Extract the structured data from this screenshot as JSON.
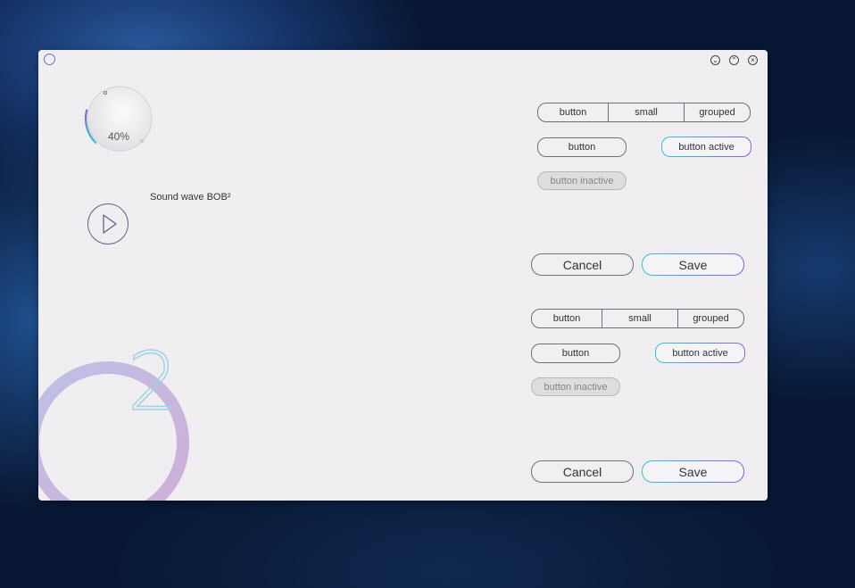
{
  "window": {
    "controls": [
      "minimize-icon",
      "maximize-icon",
      "close-icon"
    ],
    "min_glyph": "⌄",
    "max_glyph": "⌃",
    "close_glyph": "×"
  },
  "dial": {
    "value_label": "40%",
    "value": 0.4
  },
  "audio": {
    "label": "Sound wave BOB²",
    "play_icon": "play-icon"
  },
  "deco": {
    "digit": "2"
  },
  "panel1": {
    "group": [
      "button",
      "small",
      "grouped"
    ],
    "button": "button",
    "button_active": "button active",
    "button_inactive": "button inactive",
    "cancel": "Cancel",
    "save": "Save"
  },
  "panel2": {
    "group": [
      "button",
      "small",
      "grouped"
    ],
    "button": "button",
    "button_active": "button active",
    "button_inactive": "button inactive",
    "cancel": "Cancel",
    "save": "Save"
  },
  "colors": {
    "accent_start": "#2ec4d9",
    "accent_end": "#8c5fd0",
    "deco": "#c7a8d8"
  }
}
